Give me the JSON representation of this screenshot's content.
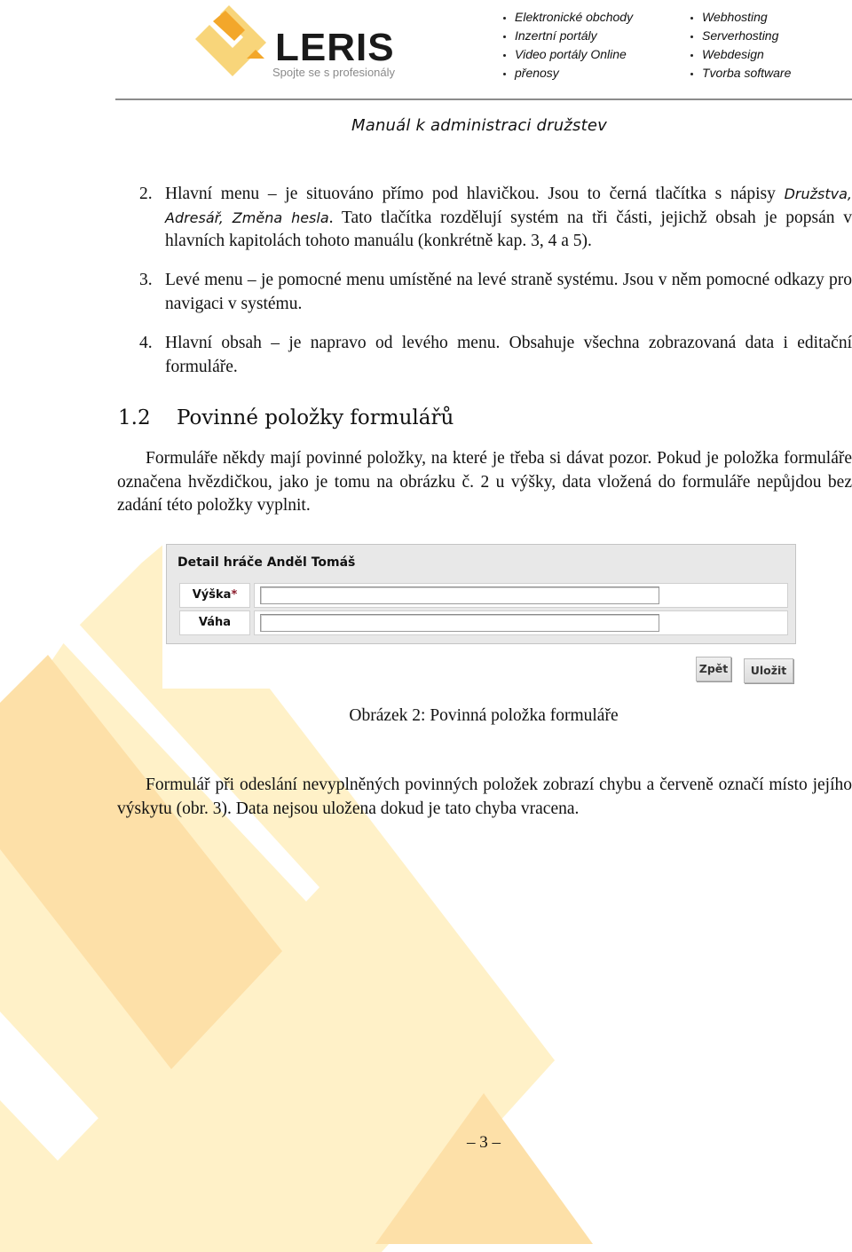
{
  "header": {
    "logo": {
      "brand": "LERIS",
      "tagline": "Spojte se s profesionály"
    },
    "services_left": [
      "Elektronické  obchody",
      "Inzertní  portály",
      "Video  portály Online",
      "přenosy"
    ],
    "services_right": [
      "Webhosting",
      "Serverhosting",
      "Webdesign",
      "Tvorba  software"
    ],
    "document_title": "Manuál  k  administraci  družstev"
  },
  "numbered_items": [
    {
      "number": "2.",
      "term": "Hlavní menu",
      "dash": " – ",
      "text_before": "je situováno přímo pod hlavičkou. Jsou to černá tlačítka s nápisy ",
      "italic": "Družstva, Adresář, Změna hesla",
      "text_after": ". Tato tlačítka rozdělují systém na tři části, jejichž obsah je popsán v hlavních kapitolách tohoto manuálu (konkrétně kap. 3, 4 a 5)."
    },
    {
      "number": "3.",
      "term": "Levé menu",
      "dash": " – ",
      "text": "je pomocné menu umístěné na levé straně systému. Jsou v něm pomocné odkazy pro navigaci v systému."
    },
    {
      "number": "4.",
      "term": "Hlavní obsah",
      "dash": " – ",
      "text": "je napravo od levého menu. Obsahuje všechna zobrazovaná data i editační formuláře."
    }
  ],
  "section": {
    "number": "1.2",
    "title": "Povinné položky formulářů",
    "paragraph_1": "Formuláře někdy mají povinné položky, na které je třeba si dávat pozor. Pokud je položka formuláře označena hvězdičkou, jako je tomu na obrázku č. 2 u výšky, data vložená do formuláře nepůjdou bez zadání této položky vyplnit.",
    "paragraph_2": "Formulář při odeslání nevyplněných povinných položek zobrazí chybu a červeně označí místo jejího výskytu (obr. 3). Data nejsou uložena dokud je tato chyba vracena."
  },
  "figure": {
    "form_title": "Detail hráče Anděl Tomáš",
    "fields": [
      {
        "label": "Výška",
        "required_marker": "*",
        "value": ""
      },
      {
        "label": "Váha",
        "required_marker": "",
        "value": ""
      }
    ],
    "buttons": {
      "back": "Zpět",
      "save": "Uložit"
    },
    "caption": "Obrázek 2: Povinná položka formuláře"
  },
  "footer": {
    "page_number": "– 3 –"
  },
  "colors": {
    "watermark_light": "#fff1c8",
    "watermark_dark": "#fde0a8",
    "logo_yellow": "#f8d57a",
    "logo_orange": "#f3a72a",
    "required_star": "#8a1a2a",
    "form_panel": "#e8e8e8"
  }
}
